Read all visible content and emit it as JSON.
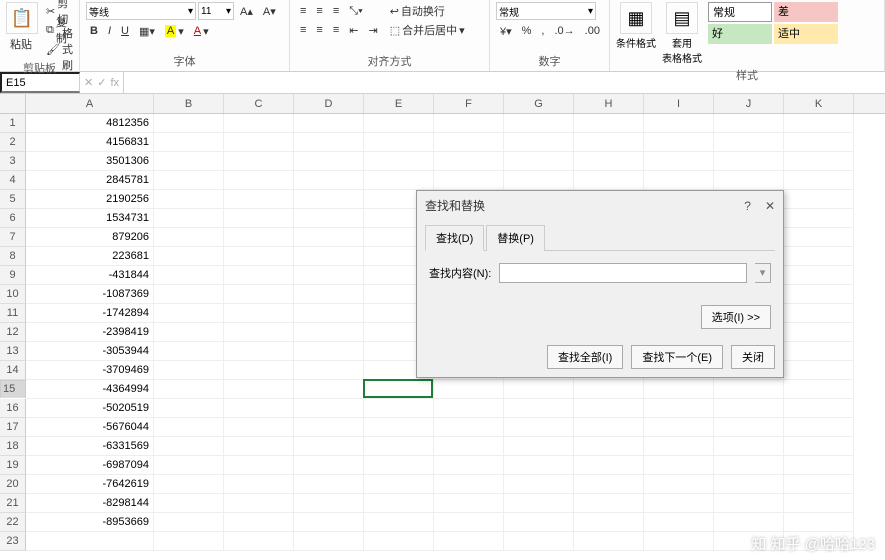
{
  "ribbon": {
    "clipboard": {
      "label": "剪贴板",
      "cut": "剪切",
      "copy": "复制",
      "paint": "格式刷",
      "paste": "粘贴"
    },
    "font": {
      "label": "字体",
      "name": "等线",
      "size": "11",
      "bold": "B",
      "italic": "I",
      "underline": "U"
    },
    "align": {
      "label": "对齐方式",
      "wrap": "自动换行",
      "merge": "合并后居中"
    },
    "number": {
      "label": "数字",
      "format": "常规"
    },
    "styles": {
      "label": "样式",
      "cond": "条件格式",
      "table": "套用\n表格格式",
      "normal": "常规",
      "bad": "差",
      "good": "好",
      "mid": "适中"
    }
  },
  "namebox": "E15",
  "fx": "fx",
  "columns": [
    "A",
    "B",
    "C",
    "D",
    "E",
    "F",
    "G",
    "H",
    "I",
    "J",
    "K"
  ],
  "cells": {
    "A": [
      "4812356",
      "4156831",
      "3501306",
      "2845781",
      "2190256",
      "1534731",
      "879206",
      "223681",
      "-431844",
      "-1087369",
      "-1742894",
      "-2398419",
      "-3053944",
      "-3709469",
      "-4364994",
      "-5020519",
      "-5676044",
      "-6331569",
      "-6987094",
      "-7642619",
      "-8298144",
      "-8953669"
    ]
  },
  "activeCell": {
    "row": 15,
    "col": "E"
  },
  "dialog": {
    "title": "查找和替换",
    "help": "?",
    "close": "✕",
    "tab_find": "查找(D)",
    "tab_replace": "替换(P)",
    "find_label": "查找内容(N):",
    "find_value": "",
    "options": "选项(I) >>",
    "find_all": "查找全部(I)",
    "find_next": "查找下一个(E)",
    "close_btn": "关闭"
  },
  "watermark": "知乎 @哈哈123"
}
